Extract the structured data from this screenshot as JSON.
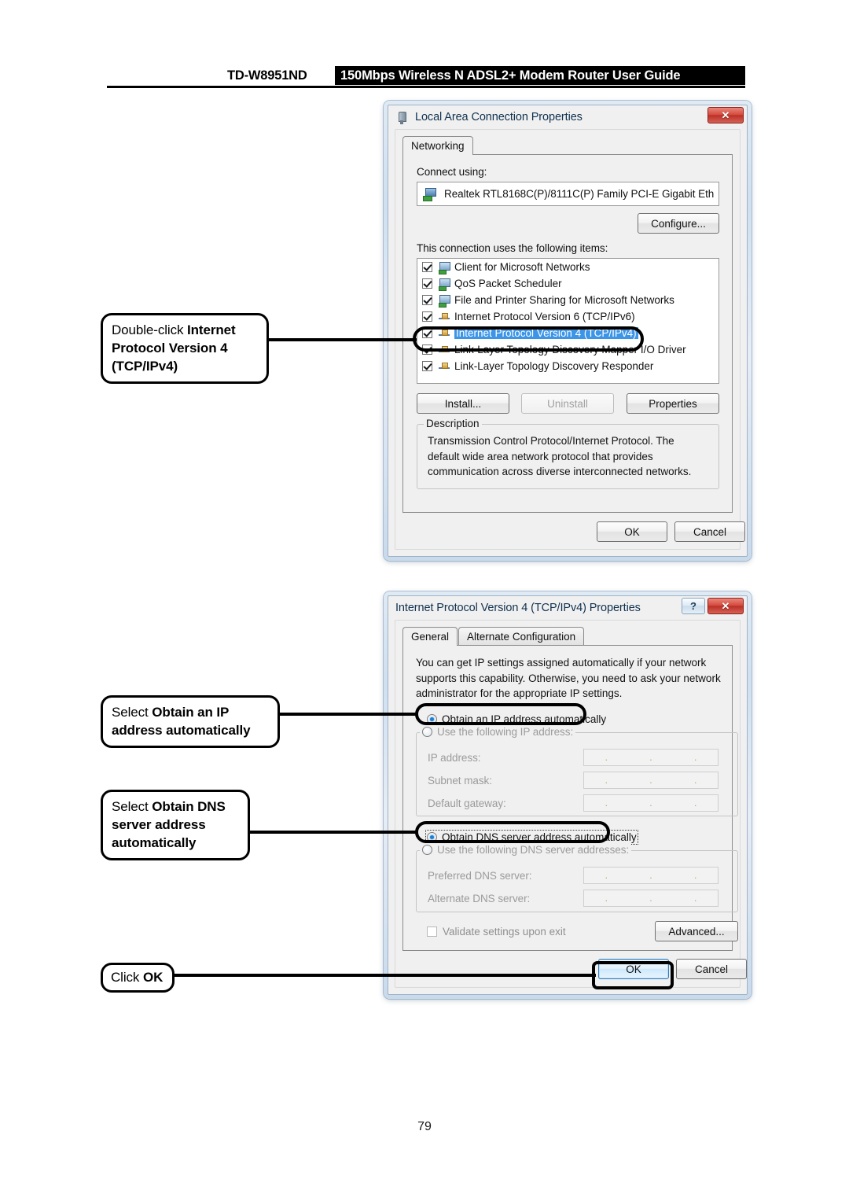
{
  "header": {
    "model": "TD-W8951ND",
    "title": "150Mbps Wireless N ADSL2+ Modem Router User Guide"
  },
  "page_number": "79",
  "dialog1": {
    "title": "Local Area Connection Properties",
    "title_icon": "network-adapter-icon",
    "close_label": "✕",
    "tabs": [
      {
        "label": "Networking",
        "active": true
      }
    ],
    "connect_using_label": "Connect using:",
    "adapter": "Realtek RTL8168C(P)/8111C(P) Family PCI-E Gigabit Eth",
    "configure_button": "Configure...",
    "items_label": "This connection uses the following items:",
    "items": [
      {
        "label": "Client for Microsoft Networks",
        "checked": true,
        "selected": false,
        "icon": "monitor-icon"
      },
      {
        "label": "QoS Packet Scheduler",
        "checked": true,
        "selected": false,
        "icon": "monitor-icon"
      },
      {
        "label": "File and Printer Sharing for Microsoft Networks",
        "checked": true,
        "selected": false,
        "icon": "monitor-icon"
      },
      {
        "label": "Internet Protocol Version 6 (TCP/IPv6)",
        "checked": true,
        "selected": false,
        "icon": "protocol-icon"
      },
      {
        "label": "Internet Protocol Version 4 (TCP/IPv4)",
        "checked": true,
        "selected": true,
        "icon": "protocol-icon"
      },
      {
        "label": "Link-Layer Topology Discovery Mapper I/O Driver",
        "checked": true,
        "selected": false,
        "icon": "protocol-icon"
      },
      {
        "label": "Link-Layer Topology Discovery Responder",
        "checked": true,
        "selected": false,
        "icon": "protocol-icon"
      }
    ],
    "install_button": "Install...",
    "uninstall_button": "Uninstall",
    "properties_button": "Properties",
    "description_legend": "Description",
    "description_text": "Transmission Control Protocol/Internet Protocol. The default wide area network protocol that provides communication across diverse interconnected networks.",
    "ok_button": "OK",
    "cancel_button": "Cancel"
  },
  "dialog2": {
    "title": "Internet Protocol Version 4 (TCP/IPv4) Properties",
    "help_label": "?",
    "close_label": "✕",
    "tabs": [
      {
        "label": "General",
        "active": true
      },
      {
        "label": "Alternate Configuration",
        "active": false
      }
    ],
    "intro_text": "You can get IP settings assigned automatically if your network supports this capability. Otherwise, you need to ask your network administrator for the appropriate IP settings.",
    "radio_obtain_ip": "Obtain an IP address automatically",
    "radio_use_ip": "Use the following IP address:",
    "ip_fields": [
      {
        "label": "IP address:",
        "value": ""
      },
      {
        "label": "Subnet mask:",
        "value": ""
      },
      {
        "label": "Default gateway:",
        "value": ""
      }
    ],
    "radio_obtain_dns": "Obtain DNS server address automatically",
    "radio_use_dns": "Use the following DNS server addresses:",
    "dns_fields": [
      {
        "label": "Preferred DNS server:",
        "value": ""
      },
      {
        "label": "Alternate DNS server:",
        "value": ""
      }
    ],
    "validate_checkbox": "Validate settings upon exit",
    "advanced_button": "Advanced...",
    "ok_button": "OK",
    "cancel_button": "Cancel"
  },
  "annotations": [
    {
      "id": "a1",
      "plain1": "Double-click ",
      "bold": "Internet Protocol Version 4 (TCP/IPv4)"
    },
    {
      "id": "a2",
      "plain1": "Select ",
      "bold": "Obtain an IP address automatically"
    },
    {
      "id": "a3",
      "plain1": "Select ",
      "bold": "Obtain DNS server address automatically"
    },
    {
      "id": "a4",
      "plain1": "Click ",
      "bold": "OK"
    }
  ],
  "colors": {
    "selection_blue": "#3d95e8",
    "close_red": "#d4493c",
    "annotation_black": "#000000"
  }
}
